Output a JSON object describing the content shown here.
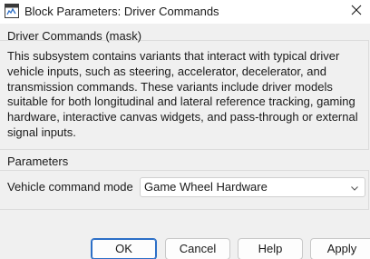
{
  "window": {
    "title": "Block Parameters: Driver Commands"
  },
  "mask_section": {
    "title": "Driver Commands (mask)",
    "description": "This subsystem contains variants that interact with typical driver vehicle inputs, such as steering, accelerator, decelerator, and transmission commands. These variants include driver models suitable for both longitudinal and lateral reference tracking, gaming hardware, interactive canvas widgets, and pass-through or external signal inputs."
  },
  "parameters_section": {
    "title": "Parameters",
    "vehicle_command_mode": {
      "label": "Vehicle command mode",
      "value": "Game Wheel Hardware"
    }
  },
  "buttons": {
    "ok": "OK",
    "cancel": "Cancel",
    "help": "Help",
    "apply": "Apply"
  },
  "icons": {
    "app": "simulink-block-icon",
    "close": "close-icon",
    "dropdown": "chevron-down-icon"
  },
  "colors": {
    "primary_border": "#2c6fc7",
    "background": "#f0f0f0"
  }
}
